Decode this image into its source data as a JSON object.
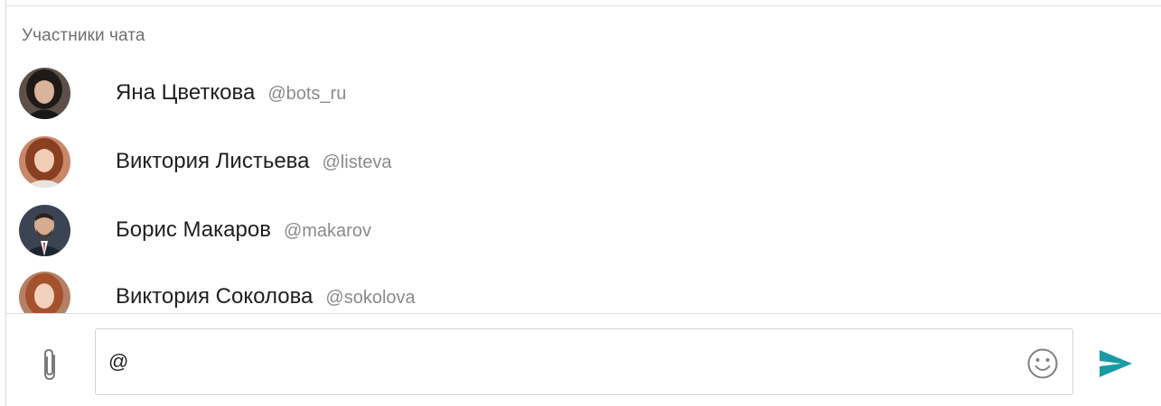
{
  "mention_panel": {
    "title": "Участники чата",
    "members": [
      {
        "name": "Яна Цветкова",
        "handle": "@bots_ru",
        "avatar": "avatar-woman-dark-hair"
      },
      {
        "name": "Виктория Листьева",
        "handle": "@listeva",
        "avatar": "avatar-woman-auburn-hair"
      },
      {
        "name": "Борис Макаров",
        "handle": "@makarov",
        "avatar": "avatar-man-beard-suit"
      },
      {
        "name": "Виктория Соколова",
        "handle": "@sokolova",
        "avatar": "avatar-woman-red-hair"
      }
    ]
  },
  "composer": {
    "input_value": "@",
    "attach_icon": "paperclip-icon",
    "emoji_icon": "smiley-icon",
    "send_icon": "send-arrow-icon"
  },
  "colors": {
    "accent": "#1a9ba3",
    "text_primary": "#1f1f1f",
    "text_secondary": "#8a8a8a",
    "border": "#d3d3d3"
  }
}
